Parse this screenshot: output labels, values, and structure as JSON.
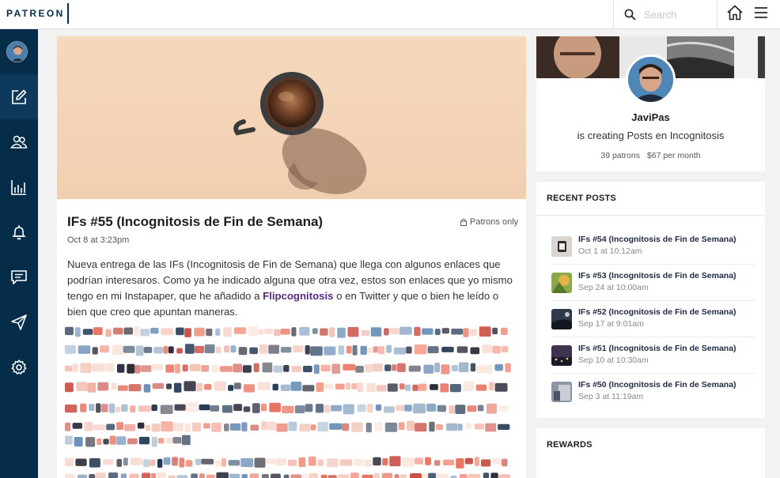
{
  "topbar": {
    "logo": "PATREON",
    "search_placeholder": "Search"
  },
  "sidebar": {
    "items": [
      {
        "icon": "edit-icon"
      },
      {
        "icon": "patrons-icon"
      },
      {
        "icon": "insights-icon"
      },
      {
        "icon": "notifications-icon"
      },
      {
        "icon": "messages-icon"
      },
      {
        "icon": "send-icon"
      },
      {
        "icon": "settings-icon"
      }
    ]
  },
  "post": {
    "title": "IFs #55 (Incognitosis de Fin de Semana)",
    "visibility": "Patrons only",
    "date": "Oct 8 at 3:23pm",
    "body_before_link": "Nueva entrega de las IFs (Incognitosis de Fin de Semana) que llega con algunos enlaces que podrían interesaros.  Como ya he indicado alguna que  otra vez, estos son enlaces que yo mismo tengo en mi Instapaper, que he  añadido a ",
    "body_link": "Flipcognitosis",
    "body_after_link": " o en Twitter y que o bien he leído o bien que creo que apuntan maneras."
  },
  "creator": {
    "name": "JaviPas",
    "tagline": "is creating Posts en Incognitosis",
    "patrons": "39 patrons",
    "earnings": "$67 per month"
  },
  "recent_posts": {
    "heading": "RECENT POSTS",
    "items": [
      {
        "title": "IFs #54 (Incognitosis de Fin de Semana)",
        "date": "Oct 1 at 10:12am"
      },
      {
        "title": "IFs #53 (Incognitosis de Fin de Semana)",
        "date": "Sep 24 at 10:00am"
      },
      {
        "title": "IFs #52 (Incognitosis de Fin de Semana)",
        "date": "Sep 17 at 9:01am"
      },
      {
        "title": "IFs #51 (Incognitosis de Fin de Semana)",
        "date": "Sep 10 at 10:30am"
      },
      {
        "title": "IFs #50 (Incognitosis de Fin de Semana)",
        "date": "Sep 3 at 11:19am"
      }
    ]
  },
  "rewards": {
    "heading": "REWARDS"
  },
  "colors": {
    "sidebar_bg": "#052d49",
    "link": "#5a2a83",
    "hero_bg": "#f1cfb1"
  }
}
